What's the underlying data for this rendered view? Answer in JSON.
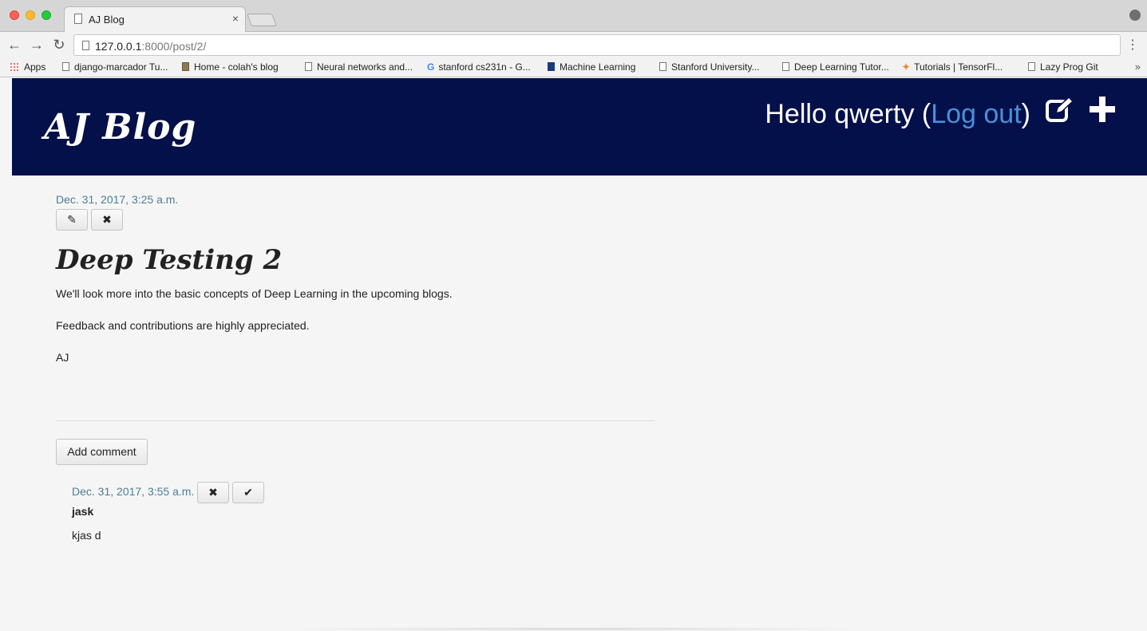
{
  "browser": {
    "tab_title": "AJ Blog",
    "tab_close": "×",
    "url_host": "127.0.0.1",
    "url_path": ":8000/post/2/",
    "bookmarks": [
      {
        "label": "Apps",
        "icon": "apps-grid-icon"
      },
      {
        "label": "django-marcador Tu...",
        "icon": "page-icon"
      },
      {
        "label": "Home - colah's blog",
        "icon": "site-favicon"
      },
      {
        "label": "Neural networks and...",
        "icon": "page-icon"
      },
      {
        "label": "stanford cs231n - G...",
        "icon": "google-icon"
      },
      {
        "label": "Machine Learning",
        "icon": "site-favicon"
      },
      {
        "label": "Stanford University...",
        "icon": "page-icon"
      },
      {
        "label": "Deep Learning Tutor...",
        "icon": "page-icon"
      },
      {
        "label": "Tutorials  |  TensorFl...",
        "icon": "tensorflow-icon"
      },
      {
        "label": "Lazy Prog Git",
        "icon": "page-icon"
      }
    ],
    "overflow": "»"
  },
  "header": {
    "brand": "AJ Blog",
    "hello": "Hello qwerty (",
    "logout": "Log out",
    "close_paren": ")"
  },
  "post": {
    "date": "Dec. 31, 2017, 3:25 a.m.",
    "edit_icon": "✎",
    "delete_icon": "✖",
    "title": "Deep Testing 2",
    "paragraphs": [
      "We'll look more into the basic concepts of Deep Learning in the upcoming blogs.",
      "Feedback and contributions are highly appreciated.",
      "AJ"
    ]
  },
  "comments": {
    "add_label": "Add comment",
    "items": [
      {
        "date": "Dec. 31, 2017, 3:55 a.m.",
        "author": "jask",
        "text": "kjas d",
        "remove_icon": "✖",
        "approve_icon": "✔"
      }
    ]
  },
  "colors": {
    "header_bg": "#04104a",
    "link": "#4c8fd8",
    "date": "#4a7f93"
  }
}
